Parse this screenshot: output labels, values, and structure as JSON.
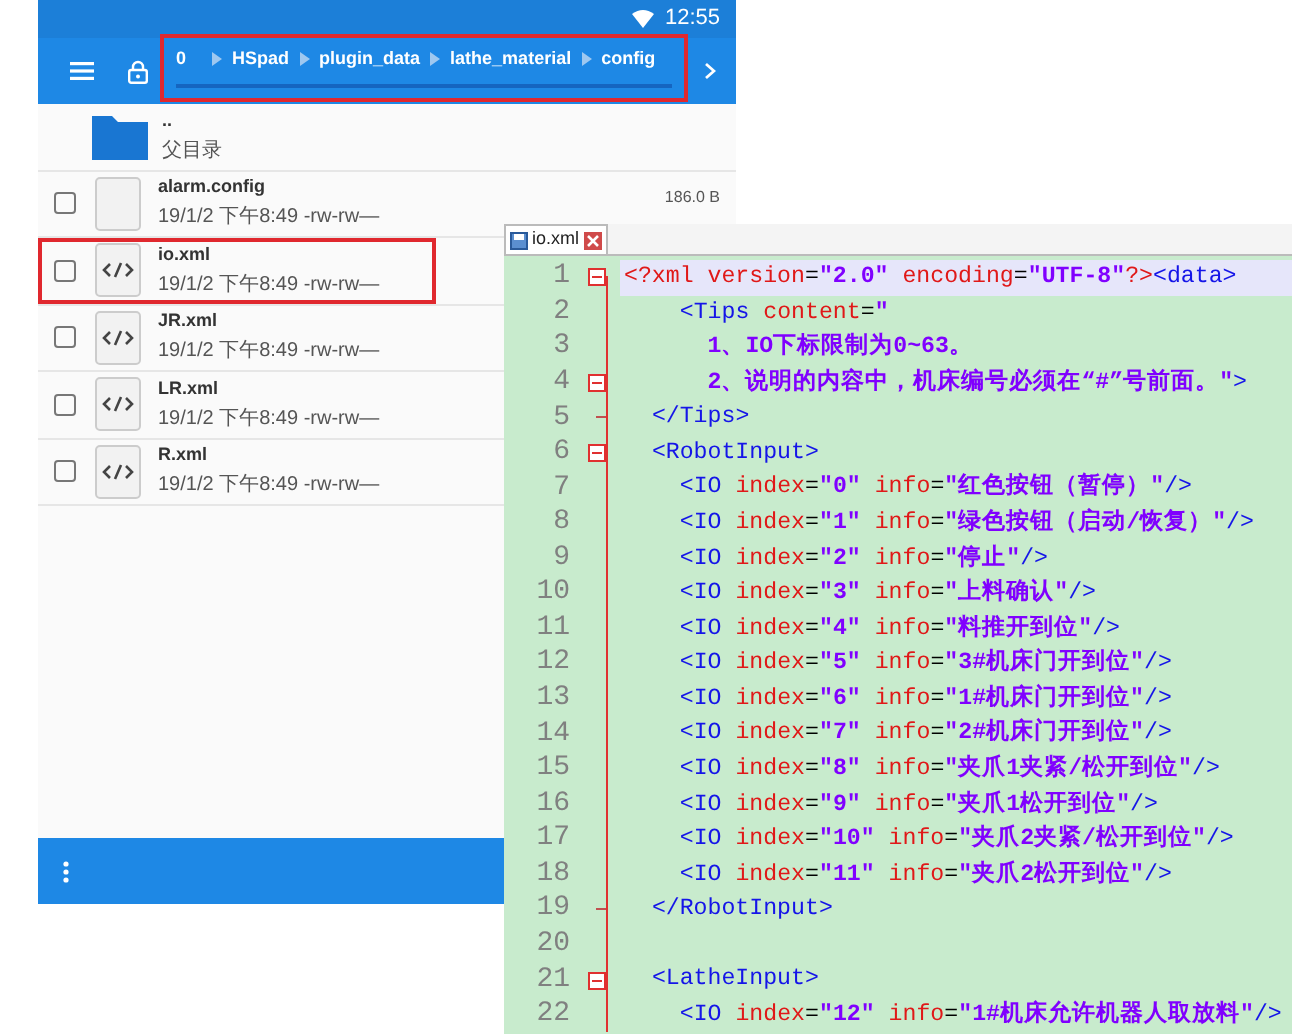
{
  "status_bar": {
    "time": "12:55"
  },
  "toolbar": {
    "highlighted": true,
    "breadcrumb": [
      "0",
      "HSpad",
      "plugin_data",
      "lathe_material",
      "config"
    ]
  },
  "files": [
    {
      "kind": "folder",
      "name": "..",
      "subtitle": "父目录"
    },
    {
      "kind": "file",
      "name": "alarm.config",
      "modified": "19/1/2 下午8:49",
      "permissions": "-rw-rw—",
      "size": "186.0 B",
      "checked": false,
      "highlighted": false
    },
    {
      "kind": "code-file",
      "name": "io.xml",
      "modified": "19/1/2 下午8:49",
      "permissions": "-rw-rw—",
      "checked": false,
      "highlighted": true
    },
    {
      "kind": "code-file",
      "name": "JR.xml",
      "modified": "19/1/2 下午8:49",
      "permissions": "-rw-rw—",
      "checked": false,
      "highlighted": false
    },
    {
      "kind": "code-file",
      "name": "LR.xml",
      "modified": "19/1/2 下午8:49",
      "permissions": "-rw-rw—",
      "checked": false,
      "highlighted": false
    },
    {
      "kind": "code-file",
      "name": "R.xml",
      "modified": "19/1/2 下午8:49",
      "permissions": "-rw-rw—",
      "checked": false,
      "highlighted": false
    }
  ],
  "editor": {
    "tab": {
      "label": "io.xml",
      "selected": true
    },
    "lines": [
      {
        "number": "1",
        "text": "<?xml version=\"2.0\" encoding=\"UTF-8\"?><data>",
        "foldable": true,
        "block_end": false,
        "current": true
      },
      {
        "number": "2",
        "text": "    <Tips content=\"",
        "foldable": false,
        "block_end": false,
        "current": false
      },
      {
        "number": "3",
        "text": "      1、IO下标限制为0~63。",
        "foldable": false,
        "block_end": false,
        "current": false
      },
      {
        "number": "4",
        "text": "      2、说明的内容中，机床编号必须在“#”号前面。\">",
        "foldable": true,
        "block_end": false,
        "current": false
      },
      {
        "number": "5",
        "text": "  </Tips>",
        "foldable": false,
        "block_end": true,
        "current": false
      },
      {
        "number": "6",
        "text": "  <RobotInput>",
        "foldable": true,
        "block_end": false,
        "current": false
      },
      {
        "number": "7",
        "text": "    <IO index=\"0\" info=\"红色按钮（暂停）\"/>",
        "foldable": false,
        "block_end": false,
        "current": false
      },
      {
        "number": "8",
        "text": "    <IO index=\"1\" info=\"绿色按钮（启动/恢复）\"/>",
        "foldable": false,
        "block_end": false,
        "current": false
      },
      {
        "number": "9",
        "text": "    <IO index=\"2\" info=\"停止\"/>",
        "foldable": false,
        "block_end": false,
        "current": false
      },
      {
        "number": "10",
        "text": "    <IO index=\"3\" info=\"上料确认\"/>",
        "foldable": false,
        "block_end": false,
        "current": false
      },
      {
        "number": "11",
        "text": "    <IO index=\"4\" info=\"料推开到位\"/>",
        "foldable": false,
        "block_end": false,
        "current": false
      },
      {
        "number": "12",
        "text": "    <IO index=\"5\" info=\"3#机床门开到位\"/>",
        "foldable": false,
        "block_end": false,
        "current": false
      },
      {
        "number": "13",
        "text": "    <IO index=\"6\" info=\"1#机床门开到位\"/>",
        "foldable": false,
        "block_end": false,
        "current": false
      },
      {
        "number": "14",
        "text": "    <IO index=\"7\" info=\"2#机床门开到位\"/>",
        "foldable": false,
        "block_end": false,
        "current": false
      },
      {
        "number": "15",
        "text": "    <IO index=\"8\" info=\"夹爪1夹紧/松开到位\"/>",
        "foldable": false,
        "block_end": false,
        "current": false
      },
      {
        "number": "16",
        "text": "    <IO index=\"9\" info=\"夹爪1松开到位\"/>",
        "foldable": false,
        "block_end": false,
        "current": false
      },
      {
        "number": "17",
        "text": "    <IO index=\"10\" info=\"夹爪2夹紧/松开到位\"/>",
        "foldable": false,
        "block_end": false,
        "current": false
      },
      {
        "number": "18",
        "text": "    <IO index=\"11\" info=\"夹爪2松开到位\"/>",
        "foldable": false,
        "block_end": false,
        "current": false
      },
      {
        "number": "19",
        "text": "  </RobotInput>",
        "foldable": false,
        "block_end": true,
        "current": false
      },
      {
        "number": "20",
        "foldable": false,
        "block_end": false,
        "current": false
      },
      {
        "number": "21",
        "text": "  <LatheInput>",
        "foldable": true,
        "block_end": false,
        "current": false
      },
      {
        "number": "22",
        "text": "    <IO index=\"12\" info=\"1#机床允许机器人取放料\"/>",
        "foldable": false,
        "block_end": false,
        "current": false
      }
    ]
  }
}
